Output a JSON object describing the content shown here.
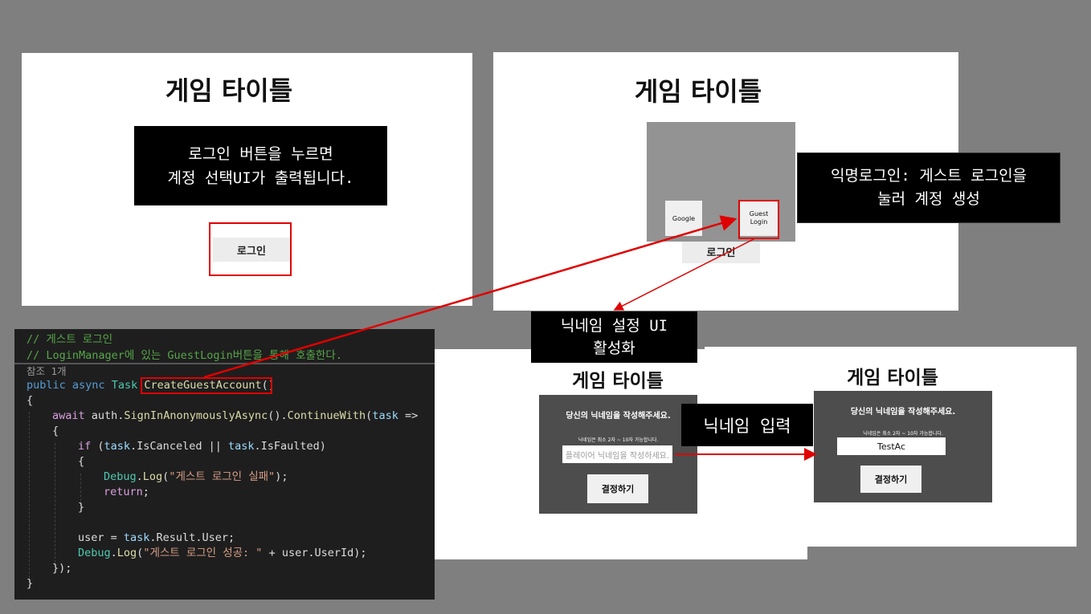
{
  "colors": {
    "background": "#7f7f7f",
    "highlight": "#e00000",
    "code_bg": "#1e1e1e"
  },
  "panel1": {
    "title": "게임 타이틀",
    "note_line1": "로그인 버튼을 누르면",
    "note_line2": "계정 선택UI가 출력됩니다.",
    "login_button": "로그인"
  },
  "panel2": {
    "title": "게임 타이틀",
    "google_button": "Google",
    "guest_button_line1": "Guest",
    "guest_button_line2": "Login",
    "login_button": "로그인",
    "note_line1": "익명로그인: 게스트 로그인을",
    "note_line2": "눌러 계정 생성"
  },
  "callout_nickname_ui": {
    "line1": "닉네임 설정 UI",
    "line2": "활성화"
  },
  "panel3": {
    "title": "게임 타이틀",
    "prompt": "당신의 닉네임을 작성해주세요.",
    "rule": "닉네임은 최소 2자 ~ 10자 가능합니다.",
    "input_placeholder": "플레이어 닉네임을 작성하세요.",
    "confirm_button": "결정하기"
  },
  "callout_nickname_input": "닉네임 입력",
  "panel4": {
    "title": "게임 타이틀",
    "prompt": "당신의 닉네임을 작성해주세요.",
    "rule": "닉네임은 최소 2자 ~ 10자 가능합니다.",
    "input_value": "TestAc",
    "confirm_button": "결정하기"
  },
  "code": {
    "comment1": "// 게스트 로그인",
    "comment2": "// LoginManager에 있는 GuestLogin버튼을 통해 호출한다.",
    "ref_count": "참조 1개",
    "l_public": "public",
    "l_async": "async",
    "l_task": "Task",
    "l_method": "CreateGuestAccount",
    "l_parens": "()",
    "brace_open": "{",
    "brace_close": "}",
    "await_kw": "await",
    "await_call_a": " auth.",
    "await_fn1": "SignInAnonymouslyAsync",
    "await_call_b": "().",
    "await_fn2": "ContinueWith",
    "await_call_c": "(",
    "await_var": "task",
    "await_call_d": " =>",
    "if_kw": "if",
    "if_a": " (",
    "if_v1": "task",
    "if_b": ".IsCanceled || ",
    "if_v2": "task",
    "if_c": ".IsFaulted)",
    "dbg1_ty": "Debug",
    "dbg1_dot": ".",
    "dbg1_fn": "Log",
    "dbg1_open": "(",
    "dbg1_str": "\"게스트 로그인 실패\"",
    "dbg1_close": ");",
    "return_kw": "return",
    "return_end": ";",
    "user_a": "user = ",
    "user_v": "task",
    "user_b": ".Result.User;",
    "dbg2_ty": "Debug",
    "dbg2_dot": ".",
    "dbg2_fn": "Log",
    "dbg2_open": "(",
    "dbg2_str": "\"게스트 로그인 성공: \"",
    "dbg2_rest": " + user.UserId);",
    "close_paren": "});"
  }
}
